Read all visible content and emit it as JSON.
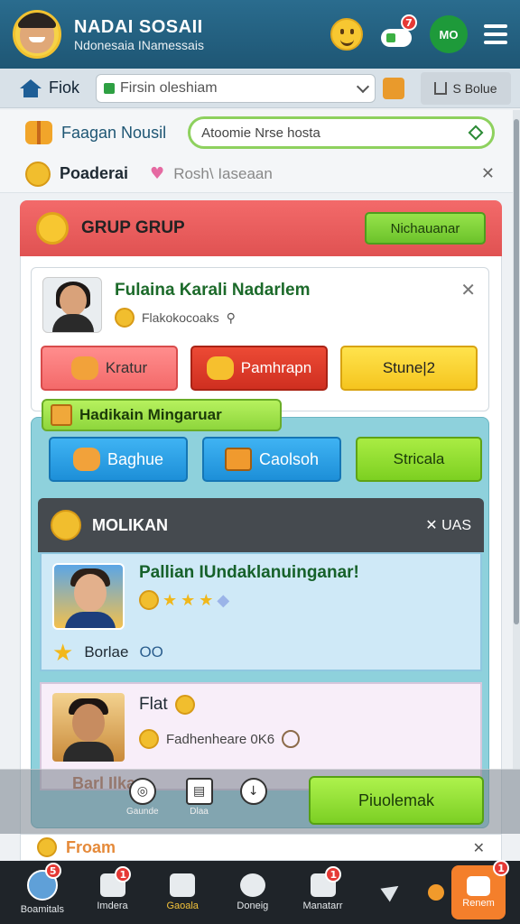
{
  "header": {
    "title": "NADAI SOSAII",
    "subtitle": "Ndonesaia INamessais",
    "mo_label": "MO",
    "game_badge": "7"
  },
  "addressbar": {
    "label": "Fiok",
    "input_value": "Firsin oleshiam",
    "share_label": "S Bolue"
  },
  "subheader": {
    "row1_title": "Faagan Nousil",
    "search_value": "Atoomie Nrse hosta",
    "row2_title": "Poaderai",
    "row2_sub": "Rosh\\ Iaseaan"
  },
  "group": {
    "title": "GRUP GRUP",
    "action_label": "Nichauanar"
  },
  "profile": {
    "name": "Fulaina Karali Nadarlem",
    "sub": "Flakokocoaks",
    "buttons": [
      "Kratur",
      "Pamhrapn",
      "Stune|2"
    ]
  },
  "rewards": {
    "tab_label": "Hadikain Mingaruar",
    "buttons": [
      "Baghue",
      "Caolsoh",
      "Stricala"
    ]
  },
  "panel": {
    "title": "MOLIKAN",
    "close_label": "UAS"
  },
  "items": [
    {
      "title": "Pallian IUndaklanuinganar!",
      "footer_label": "Borlae",
      "footer_value": "OO"
    },
    {
      "title": "Flat",
      "sub": "Fadhenheare 0K6"
    }
  ],
  "overlay": {
    "ghost_text": "Barl Ilkam",
    "float_labels": [
      "Gaunde",
      "Dlaa",
      ""
    ],
    "play_label": "Piuolemak"
  },
  "peek": {
    "text": "Froam"
  },
  "bottom_nav": {
    "items": [
      {
        "label": "Boamitals",
        "badge": "5",
        "icon": "avatar-icon"
      },
      {
        "label": "Imdera",
        "badge": "1",
        "icon": "list-icon"
      },
      {
        "label": "Gaoala",
        "badge": "",
        "icon": "camera-icon"
      },
      {
        "label": "Doneig",
        "badge": "",
        "icon": "refresh-icon"
      },
      {
        "label": "Manatarr",
        "badge": "1",
        "icon": "lightning-icon"
      },
      {
        "label": "",
        "badge": "",
        "icon": "send-icon"
      },
      {
        "label": "Renem",
        "badge": "1",
        "icon": "edit-icon"
      }
    ]
  },
  "colors": {
    "header_bg": "#1e5674",
    "group_header": "#e05252",
    "accent_green": "#7ccf24",
    "teal_section": "#8ed1dc",
    "nav_bg": "#1f2429"
  }
}
